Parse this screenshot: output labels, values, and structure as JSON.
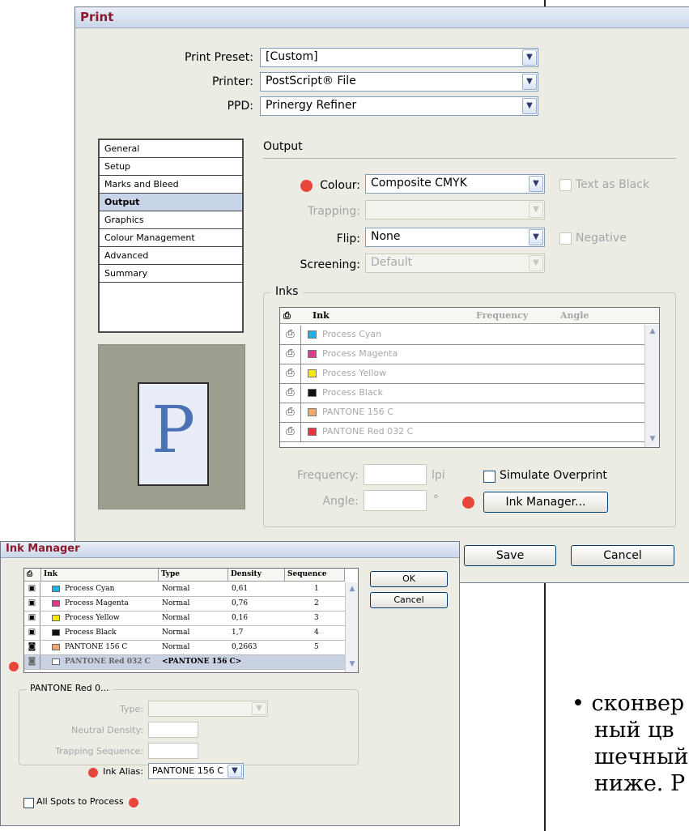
{
  "print": {
    "title": "Print",
    "preset_label": "Print Preset:",
    "preset_value": "[Custom]",
    "printer_label": "Printer:",
    "printer_value": "PostScript® File",
    "ppd_label": "PPD:",
    "ppd_value": "Prinergy Refiner",
    "categories": [
      "General",
      "Setup",
      "Marks and Bleed",
      "Output",
      "Graphics",
      "Colour Management",
      "Advanced",
      "Summary"
    ],
    "selected_category": "Output",
    "preview_letter": "P",
    "section_title": "Output",
    "colour_label": "Colour:",
    "colour_value": "Composite CMYK",
    "text_as_black_label": "Text as Black",
    "trapping_label": "Trapping:",
    "trapping_value": "",
    "flip_label": "Flip:",
    "flip_value": "None",
    "negative_label": "Negative",
    "screening_label": "Screening:",
    "screening_value": "Default",
    "inks_legend": "Inks",
    "inks_columns": [
      "Ink",
      "Frequency",
      "Angle"
    ],
    "inks": [
      {
        "name": "Process Cyan",
        "color": "#1fb1e6"
      },
      {
        "name": "Process Magenta",
        "color": "#e0388c"
      },
      {
        "name": "Process Yellow",
        "color": "#f5e60f"
      },
      {
        "name": "Process Black",
        "color": "#111111"
      },
      {
        "name": "PANTONE 156 C",
        "color": "#f1a76d"
      },
      {
        "name": "PANTONE Red 032 C",
        "color": "#ee3340"
      }
    ],
    "frequency_label": "Frequency:",
    "frequency_unit": "lpi",
    "angle_label": "Angle:",
    "angle_unit": "°",
    "simulate_overprint_label": "Simulate Overprint",
    "ink_manager_button": "Ink Manager...",
    "save_button": "Save",
    "cancel_button": "Cancel"
  },
  "ink_manager": {
    "title": "Ink Manager",
    "columns": [
      "Ink",
      "Type",
      "Density",
      "Sequence"
    ],
    "rows": [
      {
        "name": "Process Cyan",
        "type": "Normal",
        "density": "0,61",
        "sequence": "1",
        "color": "#1fb1e6"
      },
      {
        "name": "Process Magenta",
        "type": "Normal",
        "density": "0,76",
        "sequence": "2",
        "color": "#e0388c"
      },
      {
        "name": "Process Yellow",
        "type": "Normal",
        "density": "0,16",
        "sequence": "3",
        "color": "#f5e60f"
      },
      {
        "name": "Process Black",
        "type": "Normal",
        "density": "1,7",
        "sequence": "4",
        "color": "#111111"
      },
      {
        "name": "PANTONE 156 C",
        "type": "Normal",
        "density": "0,2663",
        "sequence": "5",
        "color": "#f1a76d"
      },
      {
        "name": "PANTONE Red 032 C",
        "alias": "<PANTONE 156 C>",
        "color": "#ffffff"
      }
    ],
    "ok_button": "OK",
    "cancel_button": "Cancel",
    "group_title": "PANTONE Red 0...",
    "type_label": "Type:",
    "neutral_density_label": "Neutral Density:",
    "trapping_sequence_label": "Trapping Sequence:",
    "ink_alias_label": "Ink Alias:",
    "ink_alias_value": "PANTONE 156 C",
    "all_spots_label": "All Spots to Process"
  },
  "background_text": {
    "line1": "• сконвер",
    "line2": "ный цв",
    "line3": "шечный",
    "line4": "ниже. Р"
  }
}
